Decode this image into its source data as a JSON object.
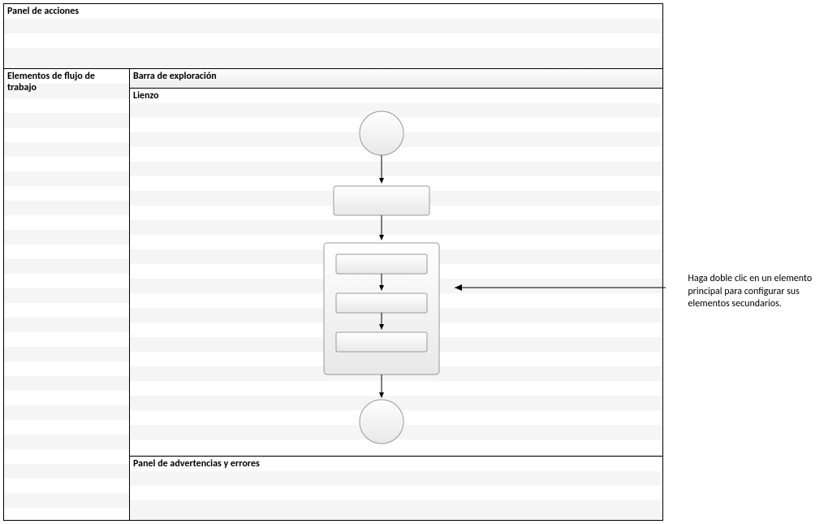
{
  "panels": {
    "actions": "Panel de acciones",
    "workflow_elements": "Elementos de flujo de trabajo",
    "explorer_bar": "Barra de exploración",
    "canvas": "Lienzo",
    "warnings": "Panel de advertencias y errores"
  },
  "annotation": "Haga doble clic en un elemento principal para configurar sus elementos secundarios.",
  "diagram": {
    "nodes": [
      {
        "type": "circle",
        "role": "start"
      },
      {
        "type": "rect",
        "role": "step"
      },
      {
        "type": "container",
        "role": "parent",
        "children": [
          {
            "type": "rect",
            "role": "child-step"
          },
          {
            "type": "rect",
            "role": "child-step"
          },
          {
            "type": "rect",
            "role": "child-step"
          }
        ]
      },
      {
        "type": "circle",
        "role": "end"
      }
    ],
    "edges": [
      {
        "from": "start",
        "to": "step"
      },
      {
        "from": "step",
        "to": "parent"
      },
      {
        "from": "parent",
        "to": "end"
      },
      {
        "from": "child-step-0",
        "to": "child-step-1"
      },
      {
        "from": "child-step-1",
        "to": "child-step-2"
      }
    ]
  }
}
